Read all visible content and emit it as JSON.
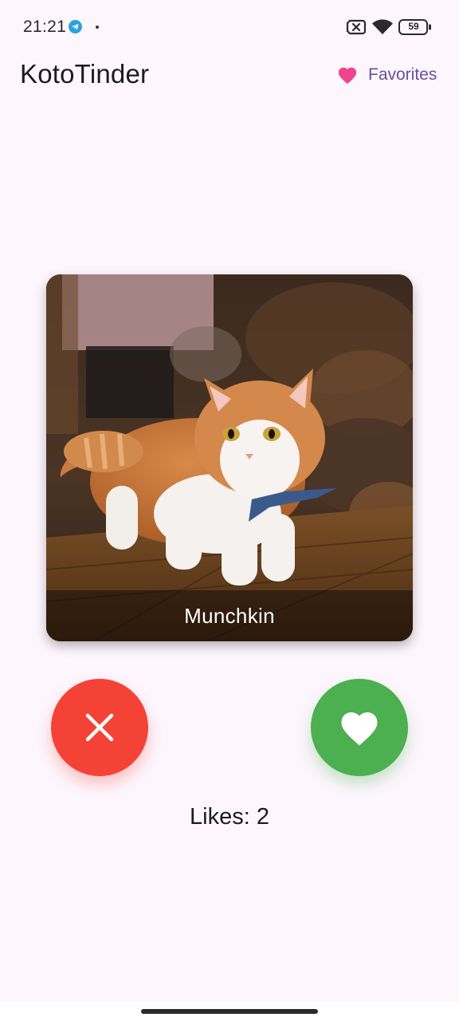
{
  "status_bar": {
    "time": "21:21",
    "battery_level": "59",
    "icons": [
      "telegram-icon",
      "sim-card-off-icon",
      "wifi-icon",
      "battery-icon"
    ]
  },
  "app_bar": {
    "title": "KotoTinder",
    "favorites_label": "Favorites",
    "favorites_icon": "heart-icon",
    "favorites_icon_color": "#f0448e",
    "favorites_label_color": "#6a4f9a"
  },
  "card": {
    "name": "Munchkin",
    "photo": "cat-photo"
  },
  "actions": {
    "dislike_icon": "close-icon",
    "dislike_color": "#f44336",
    "like_icon": "heart-icon",
    "like_color": "#4caf50"
  },
  "likes_text": "Likes: 2",
  "colors": {
    "background": "#fdf6fd"
  }
}
